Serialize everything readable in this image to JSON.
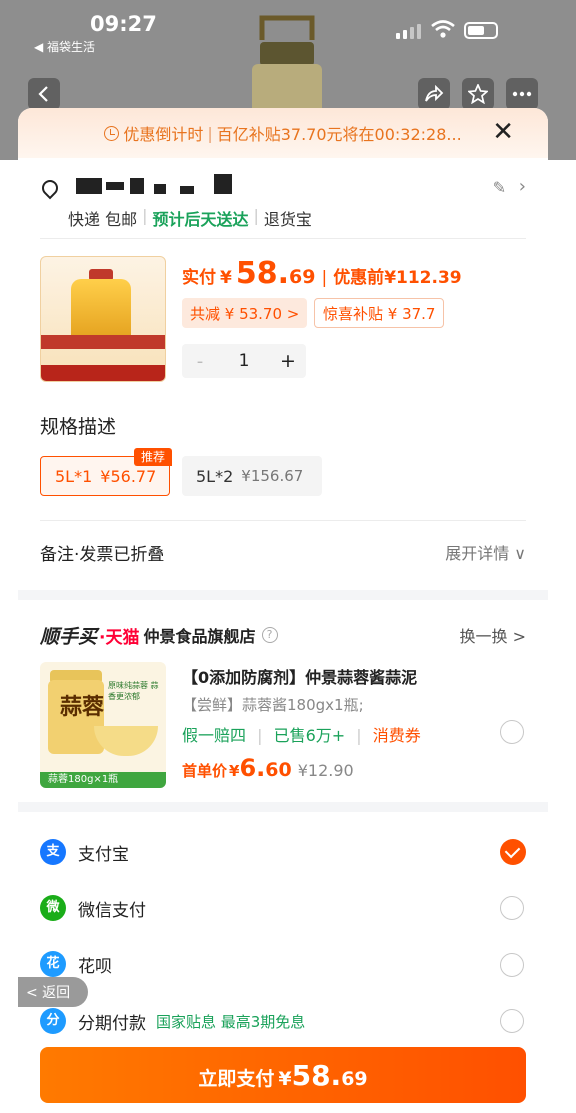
{
  "status_bar": {
    "time": "09:27",
    "back_app": "◀ 福袋生活"
  },
  "countdown": {
    "label": "优惠倒计时",
    "text": "百亿补贴37.70元将在00:32:28..."
  },
  "shipping": {
    "express": "快递 包邮",
    "estimate": "预计后天送达",
    "returns": "退货宝"
  },
  "product": {
    "paid_label": "实付",
    "currency": "¥",
    "price_int": "58.",
    "price_dec": "69",
    "pre_label": "优惠前",
    "pre_price": "¥112.39",
    "discount_chip": "共减 ¥ 53.70 >",
    "subsidy_chip": "惊喜补贴 ¥ 37.7",
    "quantity": "1",
    "minus": "-",
    "plus": "+"
  },
  "spec": {
    "title": "规格描述",
    "badge": "推荐",
    "options": [
      {
        "name": "5L*1",
        "price": "¥56.77"
      },
      {
        "name": "5L*2",
        "price": "¥156.67"
      }
    ]
  },
  "remark": {
    "label": "备注·发票已折叠",
    "expand": "展开详情 ∨"
  },
  "addon": {
    "brand": "顺手买",
    "tmall": "·天猫",
    "store": "仲景食品旗舰店",
    "help": "?",
    "swap": "换一换 >",
    "title": "【0添加防腐剂】仲景蒜蓉酱蒜泥",
    "subtitle": "【尝鲜】蒜蓉酱180gx1瓶;",
    "tag_refund": "假一赔四",
    "tag_sold": "已售6万+",
    "tag_coupon": "消费券",
    "first_label": "首单价",
    "currency": "¥",
    "price_int": "6.",
    "price_dec": "60",
    "original_price": "¥12.90",
    "img_text": "蒜蓉",
    "img_tag": "原味纯蒜蓉 蒜香更浓郁",
    "img_label": "蒜蓉180g×1瓶"
  },
  "payment": [
    {
      "name": "支付宝",
      "extra": "",
      "color": "#1677ff",
      "icon": "alipay-icon",
      "glyph": "支",
      "selected": true
    },
    {
      "name": "微信支付",
      "extra": "",
      "color": "#1aad19",
      "icon": "wechat-icon",
      "glyph": "微",
      "selected": false
    },
    {
      "name": "花呗",
      "extra": "",
      "color": "#1e9bff",
      "icon": "huabei-icon",
      "glyph": "花",
      "selected": false
    },
    {
      "name": "分期付款",
      "extra": "国家贴息 最高3期免息",
      "color": "#1e9bff",
      "icon": "installment-icon",
      "glyph": "分",
      "selected": false
    }
  ],
  "back_pill": "< 返回",
  "pay_button": {
    "label": "立即支付",
    "currency": "¥",
    "int": "58.",
    "dec": "69"
  }
}
